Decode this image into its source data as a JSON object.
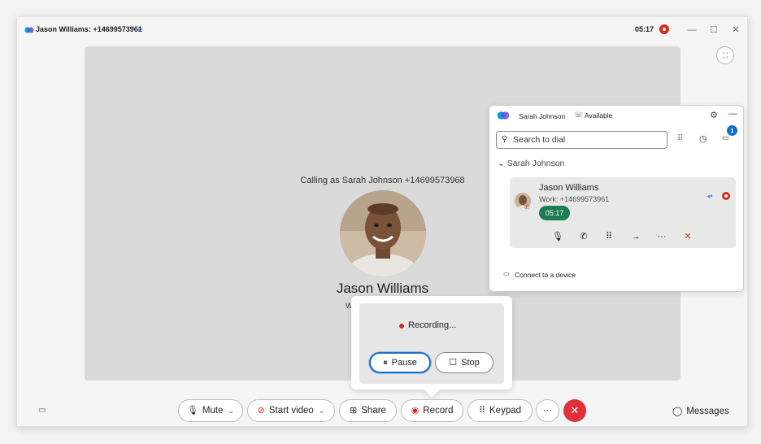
{
  "titlebar": {
    "title": "Jason Williams: +14699573961",
    "timer": "05:17",
    "app_icon": "webex-logo",
    "min_icon": "minimize-icon",
    "max_icon": "maximize-icon",
    "close_icon": "close-icon"
  },
  "video": {
    "calling_as": "Calling as Sarah Johnson +14699573968",
    "caller_name": "Jason Williams",
    "caller_number": "Work: +14699573961"
  },
  "recording": {
    "status": "Recording...",
    "pause_label": "Pause",
    "stop_label": "Stop"
  },
  "dialer": {
    "user": "Sarah Johnson",
    "status": "Available",
    "search_placeholder": "Search to dial",
    "voicemail_count": "1",
    "line_label": "Sarah Johnson",
    "call": {
      "name": "Jason Williams",
      "number": "Work: +14699573961",
      "timer": "05:17"
    },
    "connect_label": "Connect to a device"
  },
  "toolbar": {
    "mute_label": "Mute",
    "video_label": "Start video",
    "share_label": "Share",
    "record_label": "Record",
    "keypad_label": "Keypad",
    "more_label": "···",
    "messages_label": "Messages"
  },
  "colors": {
    "accent": "#1170cf",
    "record_red": "#d52b1e",
    "end_call": "#e0303a",
    "timer_green": "#1b7d52"
  }
}
